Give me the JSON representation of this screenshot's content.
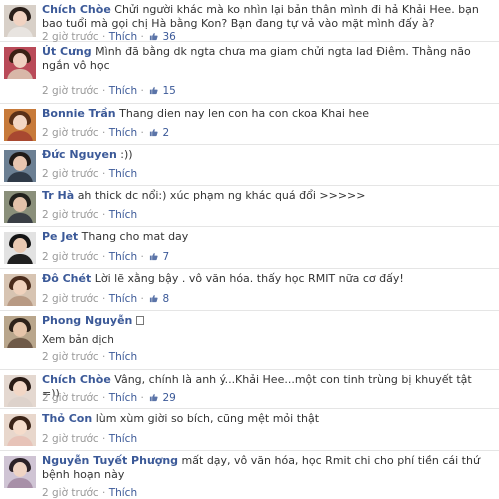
{
  "comments": [
    {
      "author": "Chích Chòe",
      "text": "Chửi người khác mà ko nhìn lại bản thân mình đi hả Khải Hee. bạn bao tuổi mà gọi chị Hà bằng Kon? Bạn đang tự vả vào mặt mình đấy à?",
      "time": "2 giờ trước",
      "like": "Thích",
      "likes": "36"
    },
    {
      "author": "Út Cưng",
      "text": "Mình đã bằng dk ngta chưa ma giam chửi ngta lad Điêm. Thằng não ngắn vô học",
      "time": "2 giờ trước",
      "like": "Thích",
      "likes": "15"
    },
    {
      "author": "Bonnie Trần",
      "text": "Thang dien nay len con ha con ckoa Khai hee",
      "time": "2 giờ trước",
      "like": "Thích",
      "likes": "2"
    },
    {
      "author": "Đức Nguyen",
      "text": ":))",
      "time": "2 giờ trước",
      "like": "Thích",
      "likes": ""
    },
    {
      "author": "Tr Hà",
      "text": "ah thick dc nổi:) xúc phạm ng khác quá đổi >>>>>",
      "time": "2 giờ trước",
      "like": "Thích",
      "likes": ""
    },
    {
      "author": "Pe Jet",
      "text": "Thang cho mat day",
      "time": "2 giờ trước",
      "like": "Thích",
      "likes": "7"
    },
    {
      "author": "Đô Chét",
      "text": "Lời lẽ xằng bậy . vô văn hóa. thấy học RMIT nữa cơ đấy!",
      "time": "2 giờ trước",
      "like": "Thích",
      "likes": "8"
    },
    {
      "author": "Phong Nguyễn",
      "text": "",
      "translate": "Xem bản dịch",
      "time": "2 giờ trước",
      "like": "Thích",
      "likes": ""
    },
    {
      "author": "Chích Chòe",
      "text": "Vâng, chính là anh ý...Khải Hee...một con tinh trùng bị khuyết tật =))",
      "time": "2 giờ trước",
      "like": "Thích",
      "likes": "29"
    },
    {
      "author": "Thỏ Con",
      "text": "lùm xùm giời so bích, cũng mệt mỏi thật",
      "time": "2 giờ trước",
      "like": "Thích",
      "likes": ""
    },
    {
      "author": "Nguyễn Tuyết Phượng",
      "text": "mất dạy, vô văn hóa, học Rmit chi cho phí tiền cái thứ bệnh hoạn này",
      "time": "2 giờ trước",
      "like": "Thích",
      "likes": ""
    }
  ],
  "ui": {
    "separator": "·",
    "icons": {
      "like": "thumbs-up-icon",
      "unknown": "box-glyph-icon"
    },
    "colors": {
      "link": "#3b5998",
      "meta": "#999999",
      "text": "#333333"
    }
  }
}
